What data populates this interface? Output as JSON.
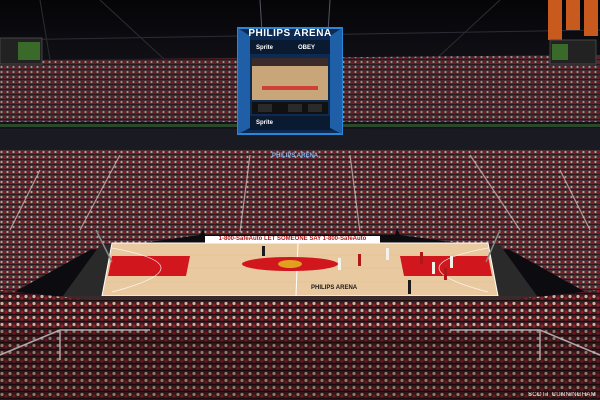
{
  "arena": {
    "scoreboard_title": "PHILIPS ARENA",
    "sponsor_top": "Sprite",
    "sponsor_obey": "OBEY",
    "sponsor_bottom": "Sprite",
    "ribbon_text": "PHILIPS ARENA"
  },
  "court": {
    "ad_strip": "1-800-SafeAuto  LET SOMEONE SAY  1-800-SafeAuto",
    "floor_logo": "PHILIPS ARENA"
  },
  "photo_credit": "SCOTT CUNNINGHAM",
  "colors": {
    "hardwood": "#e9c9a0",
    "key_paint": "#d2161e",
    "scoreboard_blue": "#2a86d8",
    "seat_red": "#8a1a22"
  }
}
